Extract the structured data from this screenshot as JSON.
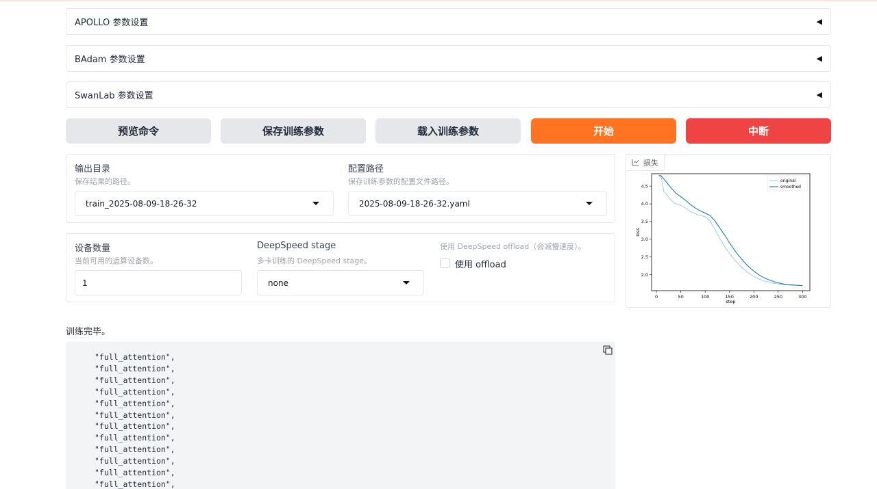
{
  "accordions": [
    {
      "label": "APOLLO 参数设置"
    },
    {
      "label": "BAdam 参数设置"
    },
    {
      "label": "SwanLab 参数设置"
    }
  ],
  "buttons": {
    "preview": "预览命令",
    "save": "保存训练参数",
    "load": "载入训练参数",
    "start": "开始",
    "abort": "中断"
  },
  "output_dir": {
    "label": "输出目录",
    "info": "保存结果的路径。",
    "value": "train_2025-08-09-18-26-32"
  },
  "config_path": {
    "label": "配置路径",
    "info": "保存训练参数的配置文件路径。",
    "value": "2025-08-09-18-26-32.yaml"
  },
  "device_count": {
    "label": "设备数量",
    "info": "当前可用的运算设备数。",
    "value": "1"
  },
  "ds_stage": {
    "label": "DeepSpeed stage",
    "info": "多卡训练的 DeepSpeed stage。",
    "value": "none"
  },
  "ds_offload": {
    "info": "使用 DeepSpeed offload（会减慢速度）。",
    "label": "使用 offload",
    "checked": false
  },
  "plot": {
    "tab_label": "损失",
    "icon": "chart-icon"
  },
  "chart_data": {
    "type": "line",
    "title": "",
    "xlabel": "step",
    "ylabel": "loss",
    "xlim": [
      -10,
      315
    ],
    "ylim": [
      1.55,
      4.85
    ],
    "xticks": [
      0,
      50,
      100,
      150,
      200,
      250,
      300
    ],
    "yticks": [
      2.0,
      2.5,
      3.0,
      3.5,
      4.0,
      4.5
    ],
    "x": [
      5,
      10,
      15,
      20,
      30,
      40,
      50,
      60,
      70,
      80,
      90,
      100,
      110,
      120,
      130,
      140,
      150,
      160,
      170,
      180,
      190,
      200,
      210,
      220,
      230,
      240,
      250,
      260,
      270,
      280,
      290,
      300
    ],
    "series": [
      {
        "name": "original",
        "color": "#a6cee3",
        "values": [
          4.8,
          4.75,
          4.35,
          4.28,
          4.1,
          4.0,
          3.96,
          3.88,
          3.78,
          3.72,
          3.67,
          3.64,
          3.52,
          3.28,
          3.02,
          2.8,
          2.6,
          2.43,
          2.28,
          2.15,
          2.04,
          1.95,
          1.88,
          1.83,
          1.79,
          1.76,
          1.74,
          1.72,
          1.71,
          1.7,
          1.7,
          1.69
        ]
      },
      {
        "name": "smoothed",
        "color": "#1f78b4",
        "values": [
          4.8,
          4.79,
          4.7,
          4.62,
          4.45,
          4.3,
          4.2,
          4.1,
          3.98,
          3.88,
          3.8,
          3.74,
          3.67,
          3.52,
          3.32,
          3.12,
          2.9,
          2.7,
          2.52,
          2.36,
          2.22,
          2.1,
          2.0,
          1.92,
          1.86,
          1.81,
          1.77,
          1.74,
          1.72,
          1.71,
          1.7,
          1.69
        ]
      }
    ],
    "legend": "top-right",
    "grid": false
  },
  "status": "训练完毕。",
  "log_lines": [
    "\"full_attention\",",
    "\"full_attention\",",
    "\"full_attention\",",
    "\"full_attention\",",
    "\"full_attention\",",
    "\"full_attention\",",
    "\"full_attention\",",
    "\"full_attention\",",
    "\"full_attention\",",
    "\"full_attention\",",
    "\"full_attention\",",
    "\"full_attention\","
  ],
  "icons": {
    "copy": "copy-icon",
    "collapse": "triangle-left-icon",
    "dropdown": "chevron-down-icon"
  }
}
